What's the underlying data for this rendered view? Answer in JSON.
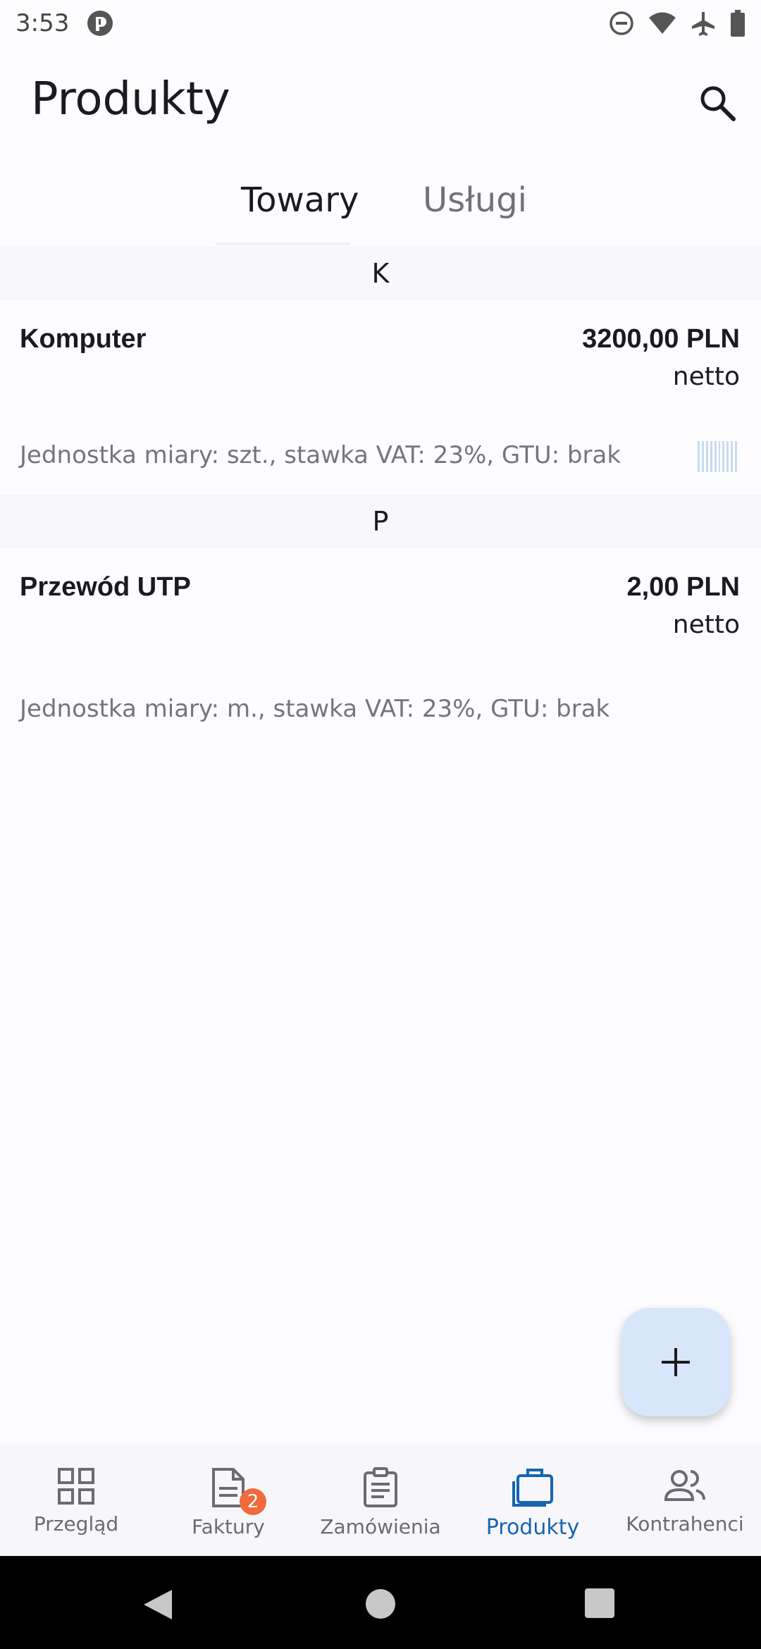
{
  "status_bar": {
    "time": "3:53"
  },
  "app_bar": {
    "title": "Produkty"
  },
  "tabs": [
    {
      "label": "Towary",
      "active": true
    },
    {
      "label": "Usługi",
      "active": false
    }
  ],
  "sections": [
    {
      "letter": "K",
      "products": [
        {
          "name": "Komputer",
          "price": "3200,00 PLN",
          "price_type": "netto",
          "details": "Jednostka miary: szt., stawka VAT: 23%, GTU: brak",
          "has_barcode": true
        }
      ]
    },
    {
      "letter": "P",
      "products": [
        {
          "name": "Przewód UTP",
          "price": "2,00 PLN",
          "price_type": "netto",
          "details": "Jednostka miary: m., stawka VAT: 23%, GTU: brak",
          "has_barcode": false
        }
      ]
    }
  ],
  "fab": {
    "icon": "plus-icon"
  },
  "bottom_nav": [
    {
      "label": "Przegląd",
      "icon": "grid-icon"
    },
    {
      "label": "Faktury",
      "icon": "document-icon",
      "badge": "2"
    },
    {
      "label": "Zamówienia",
      "icon": "clipboard-icon"
    },
    {
      "label": "Produkty",
      "icon": "briefcase-icon",
      "active": true
    },
    {
      "label": "Kontrahenci",
      "icon": "people-icon"
    }
  ],
  "colors": {
    "accent": "#1565b0",
    "badge": "#f06a3c",
    "fab": "#d8e6fb"
  }
}
